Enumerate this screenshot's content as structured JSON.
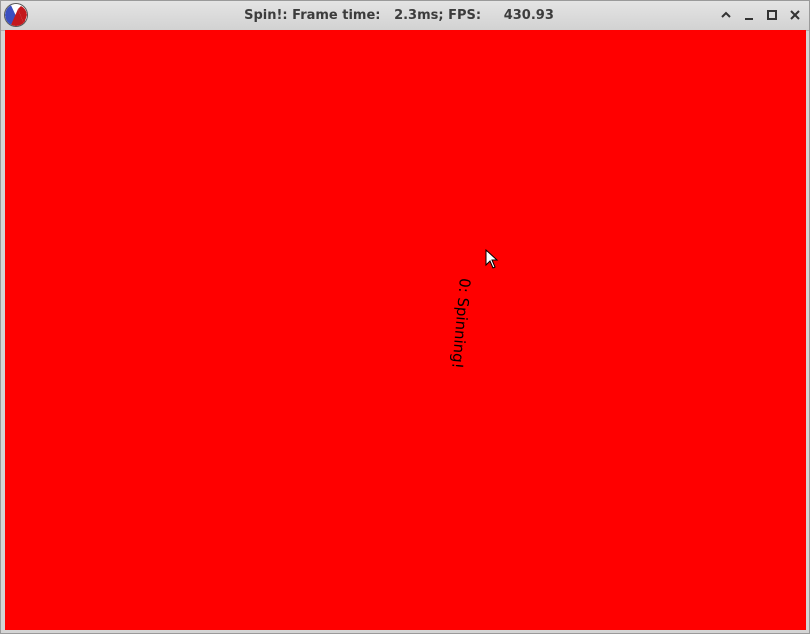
{
  "window": {
    "title": "Spin!: Frame time:   2.3ms; FPS:     430.93",
    "app_icon": "racket-logo-icon",
    "controls": [
      "chevron-up-icon",
      "minimize-icon",
      "maximize-icon",
      "close-icon"
    ]
  },
  "canvas": {
    "background_color": "#ff0000",
    "text": "0: Spinning!",
    "text_rotation_deg": 95
  },
  "cursor": {
    "icon": "mouse-pointer-icon"
  }
}
